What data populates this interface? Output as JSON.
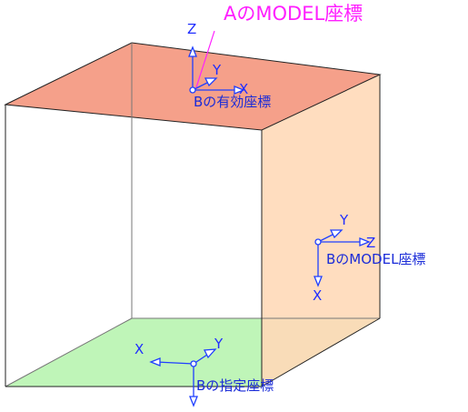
{
  "title": "AのMODEL座標",
  "faces": {
    "top_color": "#f5a08a",
    "right_color": "#ffd9b8",
    "bottom_color": "#bff5b8",
    "edge_color": "#222222",
    "hidden_edge_color": "#777777"
  },
  "colors": {
    "axis": "#1f3fff",
    "label": "#1a2bd8",
    "title": "#ff1fff"
  },
  "labels": {
    "effective": "Bの有効座標",
    "model_b": "BのMODEL座標",
    "specified": "Bの指定座標"
  },
  "axes_top": {
    "z": "Z",
    "y": "Y",
    "x": "X"
  },
  "axes_right": {
    "y": "Y",
    "z": "Z",
    "x": "X"
  },
  "axes_bottom": {
    "x": "X",
    "y": "Y"
  }
}
